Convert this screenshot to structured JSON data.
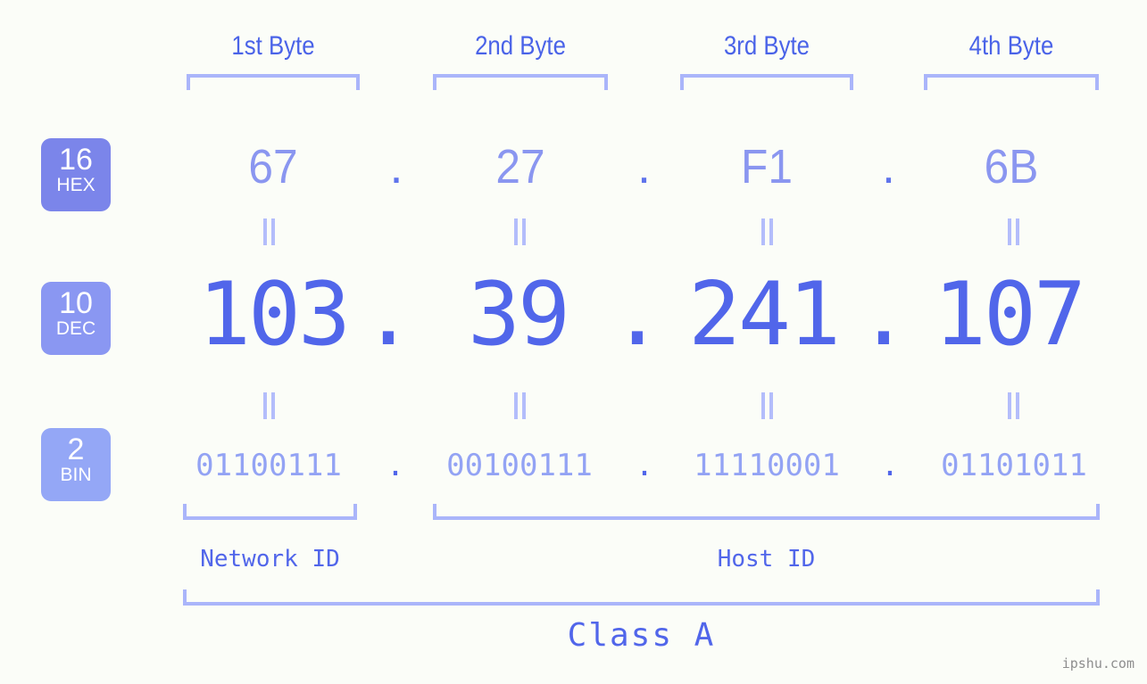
{
  "page": {
    "background": "#fbfdf8",
    "accent": "#5166ea",
    "accent_light": "#93a3f4",
    "bracket_color": "#aab5fa",
    "watermark": "ipshu.com"
  },
  "byte_headers": [
    {
      "label": "1st Byte"
    },
    {
      "label": "2nd Byte"
    },
    {
      "label": "3rd Byte"
    },
    {
      "label": "4th Byte"
    }
  ],
  "bases": [
    {
      "id": "hex",
      "radix": "16",
      "name": "HEX",
      "color": "#7b85ea"
    },
    {
      "id": "dec",
      "radix": "10",
      "name": "DEC",
      "color": "#8a97f2"
    },
    {
      "id": "bin",
      "radix": "2",
      "name": "BIN",
      "color": "#94a7f6"
    }
  ],
  "rows": {
    "hex": {
      "values": [
        "67",
        "27",
        "F1",
        "6B"
      ],
      "separator": "."
    },
    "dec": {
      "values": [
        "103",
        "39",
        "241",
        "107"
      ],
      "separator": "."
    },
    "bin": {
      "values": [
        "01100111",
        "00100111",
        "11110001",
        "01101011"
      ],
      "separator": "."
    }
  },
  "ip_address": "103.39.241.107",
  "sections": {
    "network_id": "Network ID",
    "host_id": "Host ID",
    "class": "Class A"
  }
}
